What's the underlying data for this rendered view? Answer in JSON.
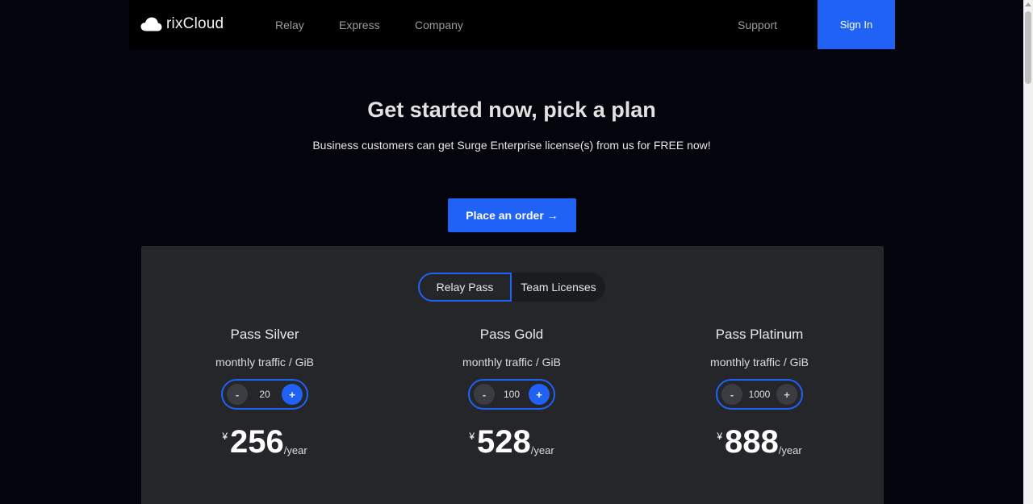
{
  "nav": {
    "brand": "rixCloud",
    "links": {
      "relay": "Relay",
      "express": "Express",
      "company": "Company",
      "support": "Support"
    },
    "signin": "Sign In"
  },
  "hero": {
    "title": "Get started now, pick a plan",
    "subtitle": "Business customers can get Surge Enterprise license(s) from us for FREE now!",
    "order_button": "Place an order →"
  },
  "tabs": {
    "active": "Relay Pass",
    "inactive": "Team Licenses"
  },
  "plans": [
    {
      "name": "Pass Silver",
      "traffic_label": "monthly traffic / GiB",
      "traffic_value": "20",
      "minus": "-",
      "plus": "+",
      "currency": "¥",
      "price": "256",
      "period": "/year"
    },
    {
      "name": "Pass Gold",
      "traffic_label": "monthly traffic / GiB",
      "traffic_value": "100",
      "minus": "-",
      "plus": "+",
      "currency": "¥",
      "price": "528",
      "period": "/year"
    },
    {
      "name": "Pass Platinum",
      "traffic_label": "monthly traffic / GiB",
      "traffic_value": "1000",
      "minus": "-",
      "plus": "+",
      "currency": "¥",
      "price": "888",
      "period": "/year"
    }
  ],
  "colors": {
    "accent": "#1f62f5",
    "background": "#04040c",
    "panel": "#25262a"
  }
}
